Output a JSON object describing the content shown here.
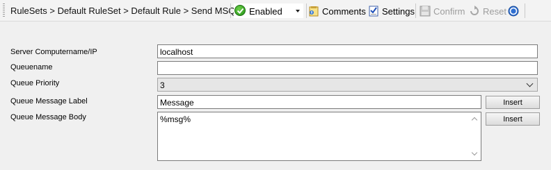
{
  "toolbar": {
    "breadcrumb": "RuleSets > Default RuleSet > Default Rule > Send MSQueue",
    "status": {
      "label": "Enabled",
      "icon": "green-check-icon"
    },
    "comments_label": "Comments",
    "settings_label": "Settings",
    "confirm_label": "Confirm",
    "reset_label": "Reset",
    "help_icon": "help-icon"
  },
  "form": {
    "server_label": "Server Computername/IP",
    "server_value": "localhost",
    "queuename_label": "Queuename",
    "queuename_value": "",
    "priority_label": "Queue Priority",
    "priority_value": "3",
    "msg_label_label": "Queue Message Label",
    "msg_label_value": "Message",
    "msg_body_label": "Queue Message Body",
    "msg_body_value": "%msg%",
    "insert_label": "Insert"
  },
  "colors": {
    "enabled_green": "#2a9b1c",
    "help_blue": "#2f6fd1",
    "disabled_text": "#9d9d9d"
  }
}
